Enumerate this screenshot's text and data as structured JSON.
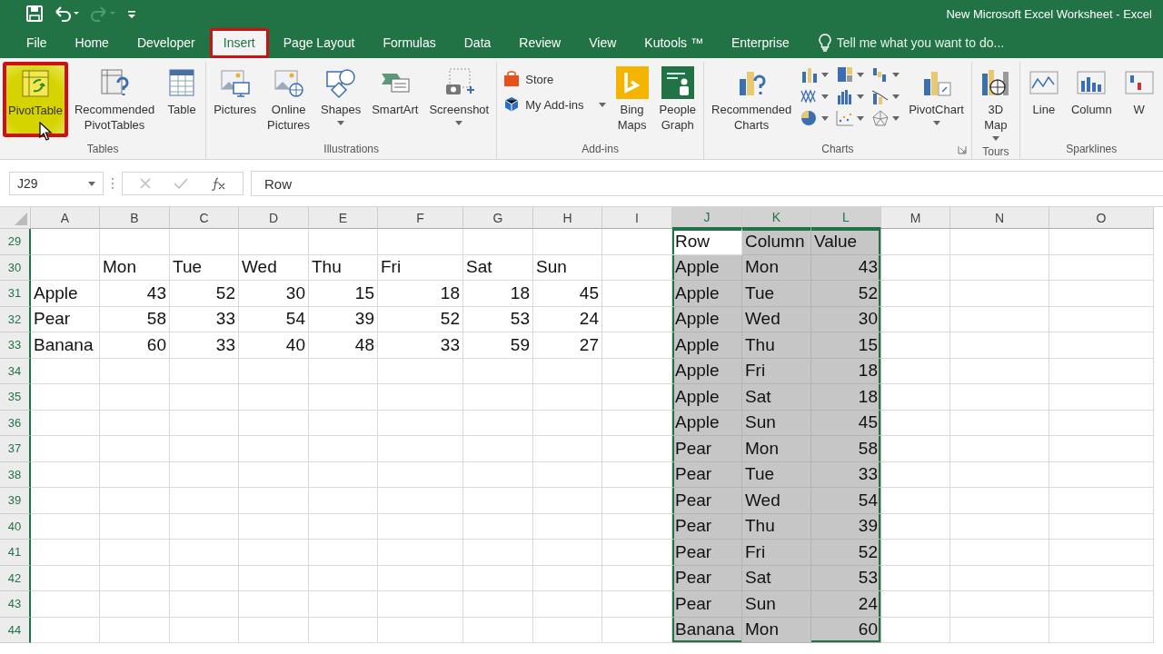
{
  "window": {
    "title": "New Microsoft Excel Worksheet - Excel"
  },
  "quick_access": [
    {
      "kind": "save",
      "disabled": false
    },
    {
      "kind": "undo",
      "disabled": false
    },
    {
      "kind": "redo",
      "disabled": true
    },
    {
      "kind": "customize",
      "disabled": false
    }
  ],
  "tabs": [
    {
      "label": "File",
      "selected": false,
      "annotated": false
    },
    {
      "label": "Home",
      "selected": false,
      "annotated": false
    },
    {
      "label": "Developer",
      "selected": false,
      "annotated": false
    },
    {
      "label": "Insert",
      "selected": true,
      "annotated": true
    },
    {
      "label": "Page Layout",
      "selected": false,
      "annotated": false
    },
    {
      "label": "Formulas",
      "selected": false,
      "annotated": false
    },
    {
      "label": "Data",
      "selected": false,
      "annotated": false
    },
    {
      "label": "Review",
      "selected": false,
      "annotated": false
    },
    {
      "label": "View",
      "selected": false,
      "annotated": false
    },
    {
      "label": "Kutools ™",
      "selected": false,
      "annotated": false
    },
    {
      "label": "Enterprise",
      "selected": false,
      "annotated": false
    }
  ],
  "tell_me": {
    "placeholder": "Tell me what you want to do..."
  },
  "ribbon": {
    "groups": [
      {
        "label": "Tables",
        "items": [
          {
            "kind": "large",
            "label": "PivotTable",
            "dropdown": false,
            "annotated": true
          },
          {
            "kind": "large",
            "label": "Recommended PivotTables",
            "dropdown": false,
            "annotated": false
          },
          {
            "kind": "large",
            "label": "Table",
            "dropdown": false,
            "annotated": false
          }
        ]
      },
      {
        "label": "Illustrations",
        "items": [
          {
            "kind": "large",
            "label": "Pictures",
            "dropdown": false,
            "annotated": false
          },
          {
            "kind": "large",
            "label": "Online Pictures",
            "dropdown": false,
            "annotated": false
          },
          {
            "kind": "large",
            "label": "Shapes",
            "dropdown": true,
            "annotated": false
          },
          {
            "kind": "large",
            "label": "SmartArt",
            "dropdown": false,
            "annotated": false
          },
          {
            "kind": "large",
            "label": "Screenshot",
            "dropdown": true,
            "annotated": false
          }
        ]
      },
      {
        "label": "Add-ins",
        "items": [
          {
            "kind": "small",
            "label": "Store",
            "dropdown": false,
            "annotated": false
          },
          {
            "kind": "small",
            "label": "My Add-ins",
            "dropdown": true,
            "annotated": false
          },
          {
            "kind": "large",
            "label": "Bing Maps",
            "dropdown": false,
            "annotated": false
          },
          {
            "kind": "large",
            "label": "People Graph",
            "dropdown": false,
            "annotated": false
          }
        ]
      },
      {
        "label": "Charts",
        "launcher": true,
        "items": [
          {
            "kind": "large",
            "label": "Recommended Charts",
            "dropdown": false,
            "annotated": false
          },
          {
            "kind": "icon",
            "dropdown": true,
            "annotated": false
          },
          {
            "kind": "icon",
            "dropdown": true,
            "annotated": false
          },
          {
            "kind": "icon",
            "dropdown": true,
            "annotated": false
          },
          {
            "kind": "icon",
            "dropdown": true,
            "annotated": false
          },
          {
            "kind": "icon",
            "dropdown": true,
            "annotated": false
          },
          {
            "kind": "icon",
            "dropdown": true,
            "annotated": false
          },
          {
            "kind": "icon",
            "dropdown": true,
            "annotated": false
          },
          {
            "kind": "icon",
            "dropdown": true,
            "annotated": false
          },
          {
            "kind": "icon",
            "dropdown": true,
            "annotated": false
          },
          {
            "kind": "large",
            "label": "PivotChart",
            "dropdown": true,
            "annotated": false
          }
        ]
      },
      {
        "label": "Tours",
        "items": [
          {
            "kind": "large",
            "label": "3D Map",
            "dropdown": true,
            "annotated": false
          }
        ]
      },
      {
        "label": "Sparklines",
        "items": [
          {
            "kind": "large",
            "label": "Line",
            "dropdown": false,
            "annotated": false
          },
          {
            "kind": "large",
            "label": "Column",
            "dropdown": false,
            "annotated": false
          },
          {
            "kind": "large",
            "label": "W",
            "dropdown": false,
            "annotated": false
          }
        ]
      }
    ]
  },
  "formula_bar": {
    "name_box": "J29",
    "formula": "Row"
  },
  "sheet": {
    "columns": [
      {
        "label": "A",
        "selected": false
      },
      {
        "label": "B",
        "selected": false
      },
      {
        "label": "C",
        "selected": false
      },
      {
        "label": "D",
        "selected": false
      },
      {
        "label": "E",
        "selected": false
      },
      {
        "label": "F",
        "selected": false
      },
      {
        "label": "G",
        "selected": false
      },
      {
        "label": "H",
        "selected": false
      },
      {
        "label": "I",
        "selected": false
      },
      {
        "label": "J",
        "selected": true
      },
      {
        "label": "K",
        "selected": true
      },
      {
        "label": "L",
        "selected": true
      },
      {
        "label": "M",
        "selected": false
      },
      {
        "label": "N",
        "selected": false
      },
      {
        "label": "O",
        "selected": false
      }
    ],
    "rows": [
      {
        "number": "29",
        "selected": true,
        "active": true,
        "cells": [
          null,
          null,
          null,
          null,
          null,
          null,
          null,
          null,
          null,
          {
            "v": "Row",
            "kind": "text"
          },
          {
            "v": "Column",
            "kind": "text"
          },
          {
            "v": "Value",
            "kind": "text"
          },
          null,
          null,
          null
        ]
      },
      {
        "number": "30",
        "selected": true,
        "active": false,
        "cells": [
          null,
          {
            "v": "Mon",
            "kind": "text"
          },
          {
            "v": "Tue",
            "kind": "text"
          },
          {
            "v": "Wed",
            "kind": "text"
          },
          {
            "v": "Thu",
            "kind": "text"
          },
          {
            "v": "Fri",
            "kind": "text"
          },
          {
            "v": "Sat",
            "kind": "text"
          },
          {
            "v": "Sun",
            "kind": "text"
          },
          null,
          {
            "v": "Apple",
            "kind": "text"
          },
          {
            "v": "Mon",
            "kind": "text"
          },
          {
            "v": "43",
            "kind": "number"
          },
          null,
          null,
          null
        ]
      },
      {
        "number": "31",
        "selected": true,
        "active": false,
        "cells": [
          {
            "v": "Apple",
            "kind": "text"
          },
          {
            "v": "43",
            "kind": "number"
          },
          {
            "v": "52",
            "kind": "number"
          },
          {
            "v": "30",
            "kind": "number"
          },
          {
            "v": "15",
            "kind": "number"
          },
          {
            "v": "18",
            "kind": "number"
          },
          {
            "v": "18",
            "kind": "number"
          },
          {
            "v": "45",
            "kind": "number"
          },
          null,
          {
            "v": "Apple",
            "kind": "text"
          },
          {
            "v": "Tue",
            "kind": "text"
          },
          {
            "v": "52",
            "kind": "number"
          },
          null,
          null,
          null
        ]
      },
      {
        "number": "32",
        "selected": true,
        "active": false,
        "cells": [
          {
            "v": "Pear",
            "kind": "text"
          },
          {
            "v": "58",
            "kind": "number"
          },
          {
            "v": "33",
            "kind": "number"
          },
          {
            "v": "54",
            "kind": "number"
          },
          {
            "v": "39",
            "kind": "number"
          },
          {
            "v": "52",
            "kind": "number"
          },
          {
            "v": "53",
            "kind": "number"
          },
          {
            "v": "24",
            "kind": "number"
          },
          null,
          {
            "v": "Apple",
            "kind": "text"
          },
          {
            "v": "Wed",
            "kind": "text"
          },
          {
            "v": "30",
            "kind": "number"
          },
          null,
          null,
          null
        ]
      },
      {
        "number": "33",
        "selected": true,
        "active": false,
        "cells": [
          {
            "v": "Banana",
            "kind": "text"
          },
          {
            "v": "60",
            "kind": "number"
          },
          {
            "v": "33",
            "kind": "number"
          },
          {
            "v": "40",
            "kind": "number"
          },
          {
            "v": "48",
            "kind": "number"
          },
          {
            "v": "33",
            "kind": "number"
          },
          {
            "v": "59",
            "kind": "number"
          },
          {
            "v": "27",
            "kind": "number"
          },
          null,
          {
            "v": "Apple",
            "kind": "text"
          },
          {
            "v": "Thu",
            "kind": "text"
          },
          {
            "v": "15",
            "kind": "number"
          },
          null,
          null,
          null
        ]
      },
      {
        "number": "34",
        "selected": true,
        "active": false,
        "cells": [
          null,
          null,
          null,
          null,
          null,
          null,
          null,
          null,
          null,
          {
            "v": "Apple",
            "kind": "text"
          },
          {
            "v": "Fri",
            "kind": "text"
          },
          {
            "v": "18",
            "kind": "number"
          },
          null,
          null,
          null
        ]
      },
      {
        "number": "35",
        "selected": true,
        "active": false,
        "cells": [
          null,
          null,
          null,
          null,
          null,
          null,
          null,
          null,
          null,
          {
            "v": "Apple",
            "kind": "text"
          },
          {
            "v": "Sat",
            "kind": "text"
          },
          {
            "v": "18",
            "kind": "number"
          },
          null,
          null,
          null
        ]
      },
      {
        "number": "36",
        "selected": true,
        "active": false,
        "cells": [
          null,
          null,
          null,
          null,
          null,
          null,
          null,
          null,
          null,
          {
            "v": "Apple",
            "kind": "text"
          },
          {
            "v": "Sun",
            "kind": "text"
          },
          {
            "v": "45",
            "kind": "number"
          },
          null,
          null,
          null
        ]
      },
      {
        "number": "37",
        "selected": true,
        "active": false,
        "cells": [
          null,
          null,
          null,
          null,
          null,
          null,
          null,
          null,
          null,
          {
            "v": "Pear",
            "kind": "text"
          },
          {
            "v": "Mon",
            "kind": "text"
          },
          {
            "v": "58",
            "kind": "number"
          },
          null,
          null,
          null
        ]
      },
      {
        "number": "38",
        "selected": true,
        "active": false,
        "cells": [
          null,
          null,
          null,
          null,
          null,
          null,
          null,
          null,
          null,
          {
            "v": "Pear",
            "kind": "text"
          },
          {
            "v": "Tue",
            "kind": "text"
          },
          {
            "v": "33",
            "kind": "number"
          },
          null,
          null,
          null
        ]
      },
      {
        "number": "39",
        "selected": true,
        "active": false,
        "cells": [
          null,
          null,
          null,
          null,
          null,
          null,
          null,
          null,
          null,
          {
            "v": "Pear",
            "kind": "text"
          },
          {
            "v": "Wed",
            "kind": "text"
          },
          {
            "v": "54",
            "kind": "number"
          },
          null,
          null,
          null
        ]
      },
      {
        "number": "40",
        "selected": true,
        "active": false,
        "cells": [
          null,
          null,
          null,
          null,
          null,
          null,
          null,
          null,
          null,
          {
            "v": "Pear",
            "kind": "text"
          },
          {
            "v": "Thu",
            "kind": "text"
          },
          {
            "v": "39",
            "kind": "number"
          },
          null,
          null,
          null
        ]
      },
      {
        "number": "41",
        "selected": true,
        "active": false,
        "cells": [
          null,
          null,
          null,
          null,
          null,
          null,
          null,
          null,
          null,
          {
            "v": "Pear",
            "kind": "text"
          },
          {
            "v": "Fri",
            "kind": "text"
          },
          {
            "v": "52",
            "kind": "number"
          },
          null,
          null,
          null
        ]
      },
      {
        "number": "42",
        "selected": true,
        "active": false,
        "cells": [
          null,
          null,
          null,
          null,
          null,
          null,
          null,
          null,
          null,
          {
            "v": "Pear",
            "kind": "text"
          },
          {
            "v": "Sat",
            "kind": "text"
          },
          {
            "v": "53",
            "kind": "number"
          },
          null,
          null,
          null
        ]
      },
      {
        "number": "43",
        "selected": true,
        "active": false,
        "cells": [
          null,
          null,
          null,
          null,
          null,
          null,
          null,
          null,
          null,
          {
            "v": "Pear",
            "kind": "text"
          },
          {
            "v": "Sun",
            "kind": "text"
          },
          {
            "v": "24",
            "kind": "number"
          },
          null,
          null,
          null
        ]
      },
      {
        "number": "44",
        "selected": true,
        "active": false,
        "cells": [
          null,
          null,
          null,
          null,
          null,
          null,
          null,
          null,
          null,
          {
            "v": "Banana",
            "kind": "text"
          },
          {
            "v": "Mon",
            "kind": "text"
          },
          {
            "v": "60",
            "kind": "number"
          },
          null,
          null,
          null
        ]
      }
    ]
  }
}
